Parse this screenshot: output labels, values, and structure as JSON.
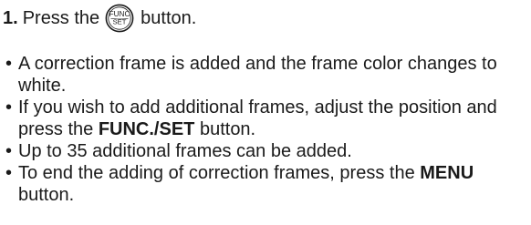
{
  "step": {
    "number": "1.",
    "text_before": "Press the",
    "icon": "func-set-button-icon",
    "icon_label_top": "FUNC",
    "icon_label_bottom": "SET",
    "text_after": "button."
  },
  "bullets": [
    {
      "line1": "A correction frame is added and the frame color changes to",
      "line2": "white."
    },
    {
      "line1": "If you wish to add additional frames, adjust the position and",
      "line2_before": "press the",
      "line2_bold": "FUNC./SET",
      "line2_after": "button."
    },
    {
      "line1": "Up to 35 additional frames can be added."
    },
    {
      "line1_before": "To end the adding of correction frames, press the",
      "line1_bold": "MENU",
      "line2": "button."
    }
  ],
  "bullet_char": "•"
}
